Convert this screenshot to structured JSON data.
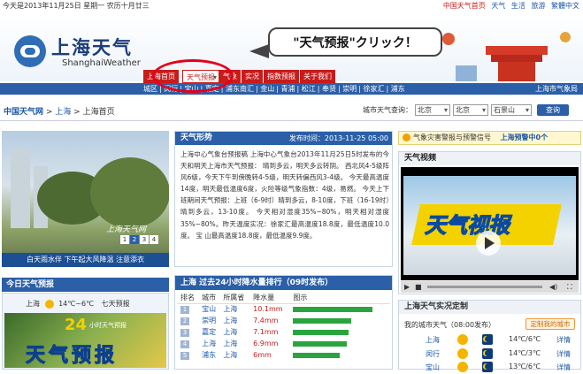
{
  "topbar": {
    "date": "今天是2013年11月25日  星期一  农历十月廿三",
    "links": [
      "中国天气首页",
      "天气",
      "生活",
      "旅游",
      "繁體中文"
    ]
  },
  "header": {
    "logo_cn": "上海天气",
    "logo_en": "ShanghaiWeather"
  },
  "callout": {
    "text": "\"天气预报\"クリック！"
  },
  "nav": {
    "tabs": [
      "上海首页",
      "天气预报",
      "气象",
      "实况",
      "指数预报",
      "关于我们"
    ],
    "sub_items": [
      "城区",
      "闵行",
      "宝山",
      "嘉定",
      "浦东南汇",
      "金山",
      "青浦",
      "松江",
      "奉贤",
      "崇明",
      "徐家汇",
      "浦东"
    ],
    "sub_right": "上海市气象局"
  },
  "breadcrumb": {
    "site": "中国天气网",
    "sep1": " > ",
    "city": "上海",
    "sep2": " > ",
    "page": "上海首页"
  },
  "query": {
    "label": "城市天气查询：",
    "province": "北京",
    "city": "北京",
    "district": "石景山",
    "button": "查询"
  },
  "photo": {
    "caption": "白天雨水伴  下午起大风降温  注意添衣",
    "watermark": "上海天气网",
    "pages": [
      "1",
      "2",
      "3",
      "4"
    ],
    "active_page": "2"
  },
  "today": {
    "title": "今日天气预报",
    "city": "上海",
    "temp": "14℃~6℃",
    "link": "七天预报",
    "banner_num": "24",
    "banner_small": "小时天气预报",
    "banner_big": "天气预报"
  },
  "weather": {
    "title": "天气形势",
    "time": "发布时间：2013-11-25 05:00",
    "body": "上海中心气象台预报稿 上海中心气象台2013年11月25日5时发布的今天和明天上海市天气预报： 晴到多云，明天多云转阴。 西北风4-5级阵风6级，今天下午到傍晚转4-5级，明天转偏西风3-4级。 今天最高温度14度，明天最低温度6度，火险等级气象指数：4级，易燃。 今天上下班期间天气预报：上班（6-9时）晴到多云，8-10度，下班（16-19时）晴到多云，13-10度。 今天相对湿度35%~80%，明天相对湿度35%~80%。昨天温度实况：徐家汇最高温度18.8度，最低温度10.0度。 宝 山最高温度18.8度，最低温度9.9度。"
  },
  "rain": {
    "title": "上海 过去24小时降水量排行（09时发布）",
    "columns": [
      "排名",
      "城市",
      "所属省",
      "降水量",
      "图示"
    ],
    "rows": [
      {
        "rank": "1",
        "city": "宝山",
        "prov": "上海",
        "value": "10.1mm",
        "frac": 1.0
      },
      {
        "rank": "2",
        "city": "崇明",
        "prov": "上海",
        "value": "7.4mm",
        "frac": 0.73
      },
      {
        "rank": "3",
        "city": "嘉定",
        "prov": "上海",
        "value": "7.1mm",
        "frac": 0.7
      },
      {
        "rank": "4",
        "city": "上海",
        "prov": "上海",
        "value": "6.9mm",
        "frac": 0.68
      },
      {
        "rank": "5",
        "city": "浦东",
        "prov": "上海",
        "value": "6mm",
        "frac": 0.59
      }
    ]
  },
  "alert": {
    "label": "气象灾害警报与预警信号",
    "status": "上海预警中0个"
  },
  "video": {
    "title": "天气视频",
    "screen_text": "天气视报"
  },
  "live": {
    "title": "上海天气实况定制",
    "mycity_label": "我的城市天气",
    "mycity_time": "（08:00发布）",
    "button": "定制我的城市",
    "rows": [
      {
        "city": "上海",
        "temp": "14℃/6℃",
        "link": "详情"
      },
      {
        "city": "闵行",
        "temp": "14℃/3℃",
        "link": "详情"
      },
      {
        "city": "宝山",
        "temp": "13℃/6℃",
        "link": "详情"
      }
    ]
  },
  "colors": {
    "brand_blue": "#2b5fa7",
    "nav_red": "#c81b1b",
    "highlight": "#e4001b"
  }
}
